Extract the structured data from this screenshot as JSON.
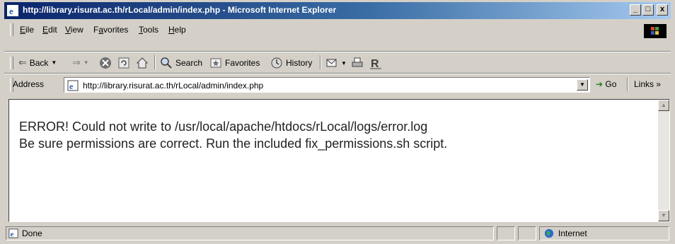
{
  "window": {
    "title": "http://library.risurat.ac.th/rLocal/admin/index.php - Microsoft Internet Explorer",
    "controls": {
      "minimize": "_",
      "maximize": "□",
      "close": "x"
    }
  },
  "menubar": {
    "items": [
      {
        "key": "E",
        "rest": "ile"
      },
      {
        "key": "E",
        "rest": "dit"
      },
      {
        "key": "V",
        "rest": "iew"
      },
      {
        "pre": "F",
        "key": "a",
        "rest": "vorites"
      },
      {
        "key": "T",
        "rest": "ools"
      },
      {
        "key": "H",
        "rest": "elp"
      }
    ],
    "items_display": [
      "File",
      "Edit",
      "View",
      "Favorites",
      "Tools",
      "Help"
    ]
  },
  "toolbar": {
    "back_label": "Back",
    "forward_label": "",
    "search_label": "Search",
    "favorites_label": "Favorites",
    "history_label": "History"
  },
  "address": {
    "label": "Address",
    "url": "http://library.risurat.ac.th/rLocal/admin/index.php",
    "go_label": "Go",
    "links_label": "Links »"
  },
  "page": {
    "line1": "ERROR! Could not write to /usr/local/apache/htdocs/rLocal/logs/error.log",
    "line2": "Be sure permissions are correct. Run the included fix_permissions.sh script."
  },
  "status": {
    "text": "Done",
    "zone": "Internet"
  },
  "colors": {
    "title_start": "#0a246a",
    "title_end": "#a6caf0",
    "chrome": "#d4d0c8"
  }
}
